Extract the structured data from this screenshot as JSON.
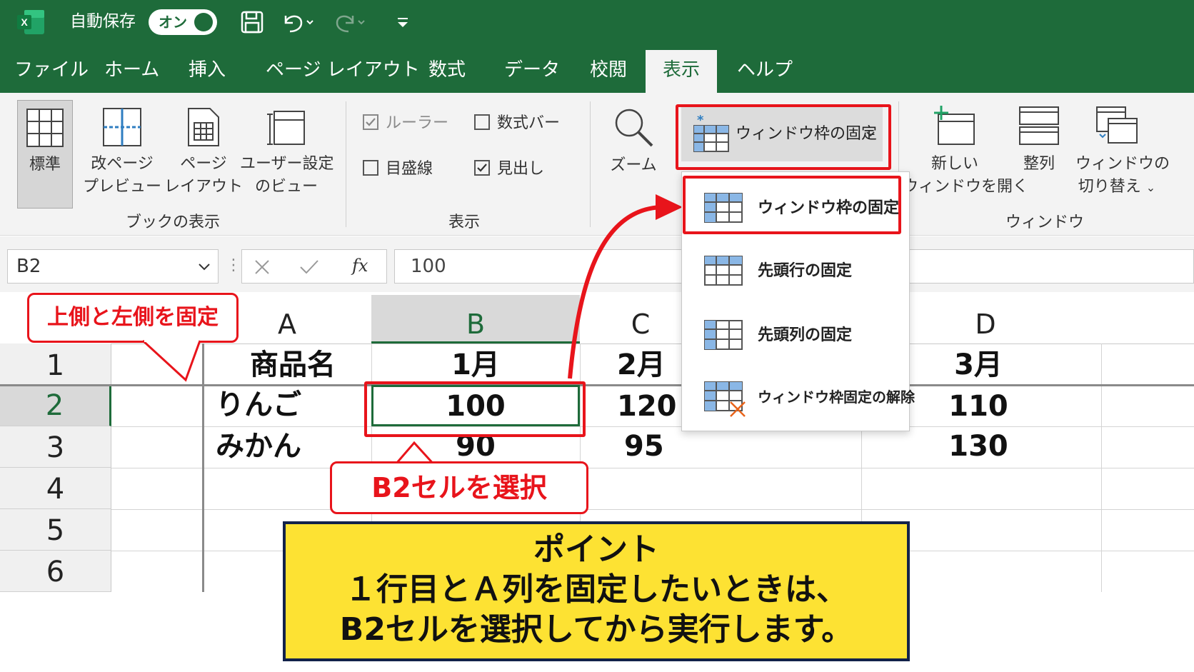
{
  "titlebar": {
    "autosave_label": "自動保存",
    "autosave_state": "オン",
    "app_logo": "X"
  },
  "menu": {
    "tabs": [
      "ファイル",
      "ホーム",
      "挿入",
      "ページ レイアウト",
      "数式",
      "データ",
      "校閲",
      "表示",
      "ヘルプ"
    ],
    "active_tab": "表示"
  },
  "ribbon": {
    "book_view": {
      "group_label": "ブックの表示",
      "normal": "標準",
      "page_break_1": "改ページ",
      "page_break_2": "プレビュー",
      "page_layout_1": "ページ",
      "page_layout_2": "レイアウト",
      "custom_1": "ユーザー設定",
      "custom_2": "のビュー"
    },
    "show": {
      "group_label": "表示",
      "ruler": "ルーラー",
      "formula_bar": "数式バー",
      "gridlines": "目盛線",
      "headings": "見出し"
    },
    "zoom": {
      "label": "ズーム"
    },
    "freeze_button": "ウィンドウ枠の固定",
    "window": {
      "group_label": "ウィンドウ",
      "new_window_1": "新しい",
      "new_window_2": "ウィンドウを開く",
      "arrange": "整列",
      "switch_1": "ウィンドウの",
      "switch_2": "切り替え"
    }
  },
  "formula": {
    "name_box": "B2",
    "fx": "fx",
    "value": "100"
  },
  "dropdown": {
    "items": [
      "ウィンドウ枠の固定",
      "先頭行の固定",
      "先頭列の固定",
      "ウィンドウ枠固定の解除"
    ]
  },
  "sheet": {
    "columns": [
      "A",
      "B",
      "C",
      "D"
    ],
    "rows": [
      "1",
      "2",
      "3",
      "4",
      "5",
      "6"
    ],
    "row1": [
      "商品名",
      "1月",
      "2月",
      "3月"
    ],
    "row2": [
      "りんご",
      "100",
      "120",
      "110"
    ],
    "row3": [
      "みかん",
      "90",
      "95",
      "130"
    ]
  },
  "callouts": {
    "freeze_top_left": "上側と左側を固定",
    "select_b2": "B2セルを選択"
  },
  "point": {
    "title": "ポイント",
    "line1": "１行目とＡ列を固定したいときは、",
    "line2": "B2セルを選択してから実行します。"
  },
  "colors": {
    "excel_green": "#1e6b3a",
    "highlight_red": "#e8141b",
    "note_yellow": "#fde233",
    "note_border": "#12224a"
  },
  "icons": [
    "excel-logo-icon",
    "save-icon",
    "undo-icon",
    "redo-icon",
    "customize-icon",
    "normal-view-icon",
    "page-break-icon",
    "page-layout-icon",
    "custom-view-icon",
    "zoom-icon",
    "freeze-panes-icon",
    "new-window-icon",
    "arrange-icon",
    "switch-window-icon",
    "cancel-icon",
    "enter-icon"
  ]
}
